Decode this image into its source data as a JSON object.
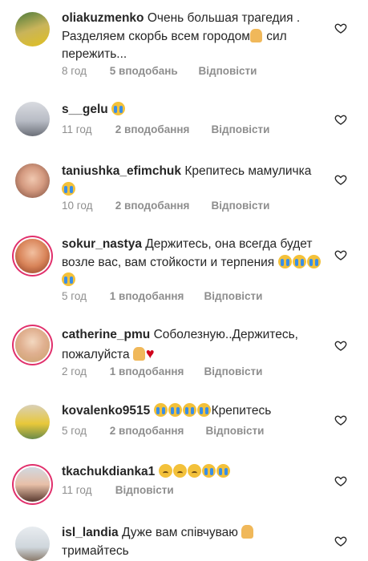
{
  "comments": [
    {
      "user": "oliakuzmenko",
      "text": "Очень большая трагедия . Разделяем скорбь всем городом",
      "text_after": " сил пережить...",
      "time": "8 год",
      "likes": "5 вподобань",
      "reply": "Відповісти"
    },
    {
      "user": "s__gelu",
      "text": "",
      "time": "11 год",
      "likes": "2 вподобання",
      "reply": "Відповісти"
    },
    {
      "user": "taniushka_efimchuk",
      "text": "Крепитесь мамуличка",
      "time": "10 год",
      "likes": "2 вподобання",
      "reply": "Відповісти"
    },
    {
      "user": "sokur_nastya",
      "text": "Держитесь, она всегда будет возле вас,  вам стойкости и терпения",
      "time": "5 год",
      "likes": "1 вподобання",
      "reply": "Відповісти"
    },
    {
      "user": "catherine_pmu",
      "text": "Соболезную..Держитесь, пожалуйста",
      "time": "2 год",
      "likes": "1 вподобання",
      "reply": "Відповісти"
    },
    {
      "user": "kovalenko9515",
      "text": "Крепитесь",
      "time": "5 год",
      "likes": "2 вподобання",
      "reply": "Відповісти"
    },
    {
      "user": "tkachukdianka1",
      "text": "",
      "time": "11 год",
      "likes": "",
      "reply": "Відповісти"
    },
    {
      "user": "isl_landia",
      "text": "Дуже вам співчуваю",
      "text_after": "тримайтесь",
      "time": "",
      "likes": "",
      "reply": ""
    }
  ],
  "icons": {
    "like": "heart-outline-icon",
    "emoji_cry": "loudly-crying-face",
    "emoji_sad": "disappointed-face",
    "emoji_pray": "folded-hands",
    "emoji_heart": "red-heart"
  },
  "colors": {
    "meta": "#8e8e8e",
    "text": "#262626",
    "story_ring": "#e1306c"
  }
}
